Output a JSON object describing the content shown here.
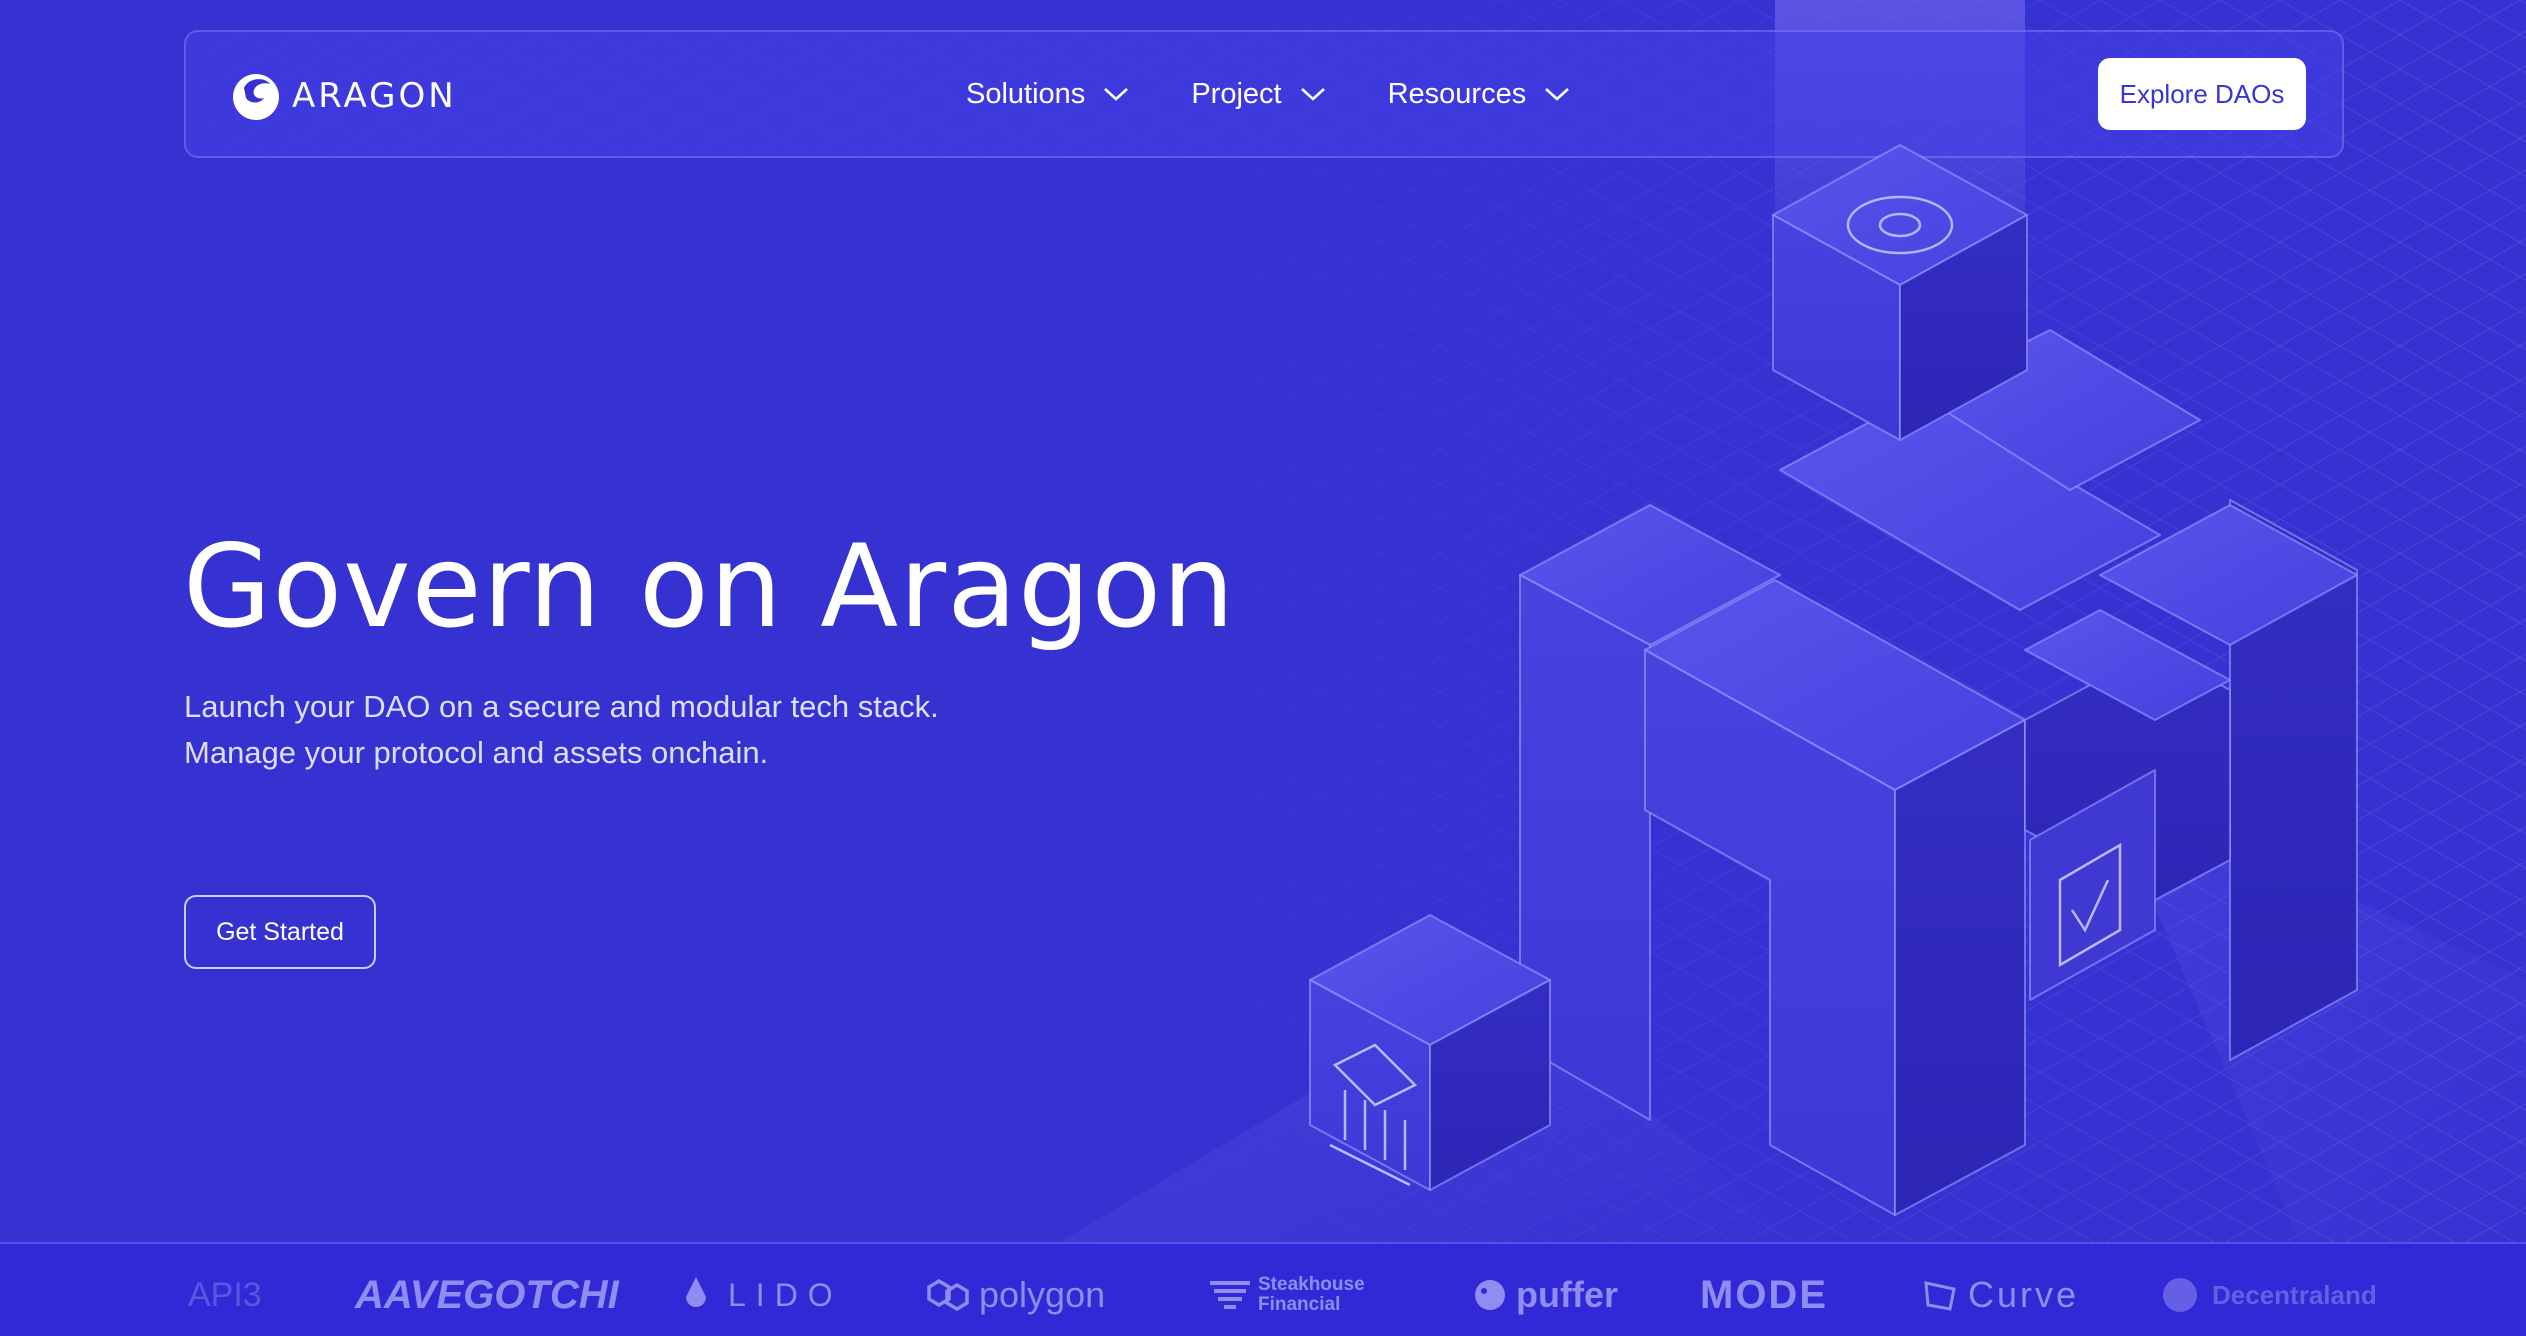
{
  "brand": {
    "name": "ARAGON"
  },
  "nav": {
    "links": [
      {
        "label": "Solutions"
      },
      {
        "label": "Project"
      },
      {
        "label": "Resources"
      }
    ],
    "cta_label": "Explore DAOs"
  },
  "hero": {
    "title": "Govern on Aragon",
    "subtitle_line1": "Launch your DAO on a secure and modular tech stack.",
    "subtitle_line2": "Manage your protocol and assets onchain.",
    "cta_label": "Get Started"
  },
  "partners": [
    {
      "name": "API3"
    },
    {
      "name": "AAVEGOTCHI"
    },
    {
      "name": "LIDO"
    },
    {
      "name": "polygon"
    },
    {
      "name": "Steakhouse",
      "name2": "Financial"
    },
    {
      "name": "puffer"
    },
    {
      "name": "MODE"
    },
    {
      "name": "Curve"
    },
    {
      "name": "Decentraland"
    }
  ],
  "colors": {
    "background": "#3731d4",
    "accent_text": "#3a34d2",
    "white": "#ffffff"
  }
}
